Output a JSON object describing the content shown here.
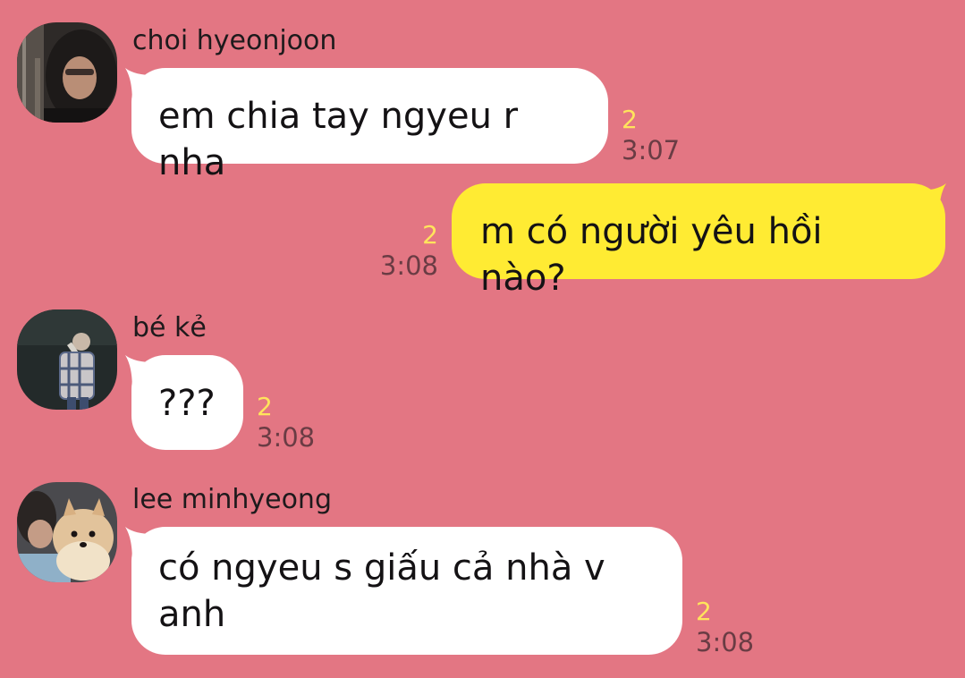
{
  "chat": {
    "colors": {
      "background": "#e37683",
      "incoming_bubble": "#ffffff",
      "outgoing_bubble": "#ffeb33",
      "unread_count": "#ffe45c",
      "timestamp": "#6a3c44"
    },
    "messages": [
      {
        "direction": "incoming",
        "sender": "choi hyeonjoon",
        "avatar": "dark-hooded-person-photo",
        "text": "em chia tay ngyeu r nha",
        "unread": "2",
        "time": "3:07"
      },
      {
        "direction": "outgoing",
        "text": "m có người yêu hồi nào?",
        "unread": "2",
        "time": "3:08"
      },
      {
        "direction": "incoming",
        "sender": "bé kẻ",
        "avatar": "person-in-plaid-shirt-photo",
        "text": "???",
        "unread": "2",
        "time": "3:08"
      },
      {
        "direction": "incoming",
        "sender": "lee minhyeong",
        "avatar": "person-with-pomeranian-photo",
        "text": "có ngyeu s giấu cả nhà v\nanh",
        "unread": "2",
        "time": "3:08"
      }
    ]
  }
}
